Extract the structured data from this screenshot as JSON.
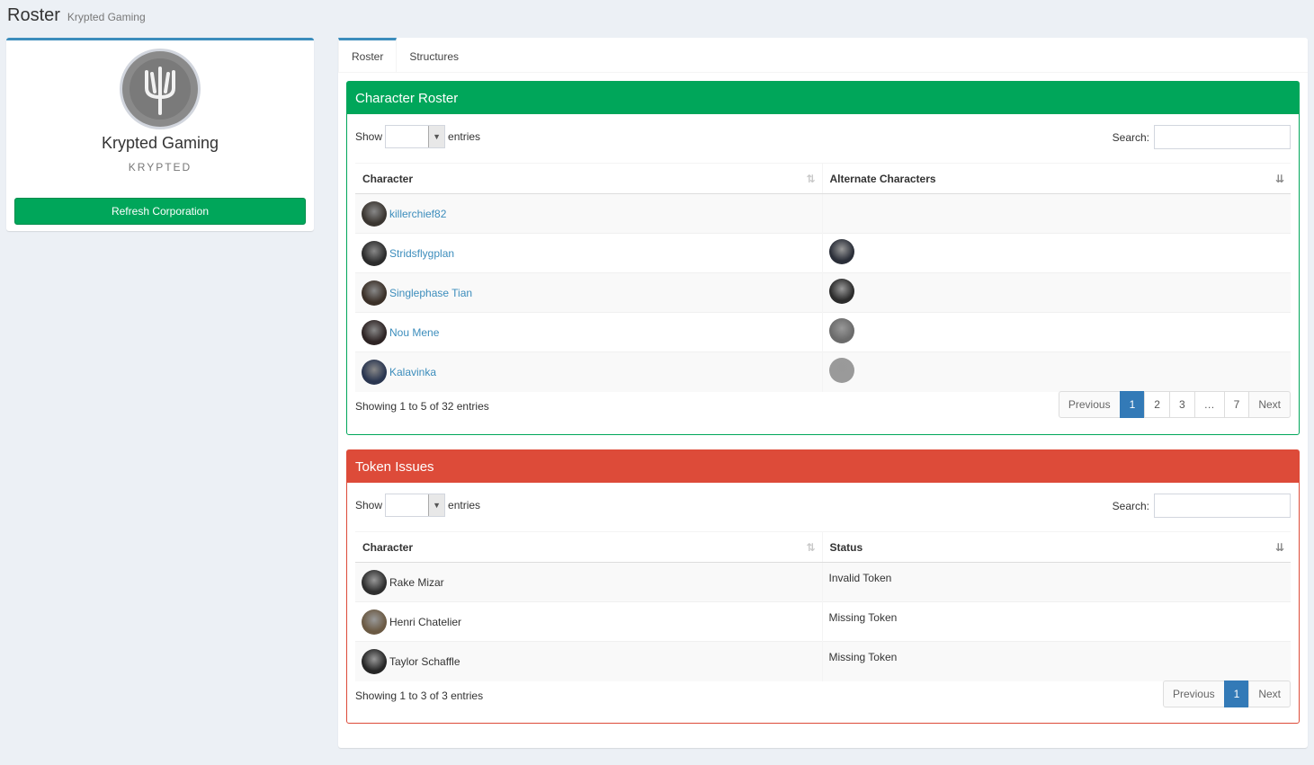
{
  "header": {
    "title": "Roster",
    "subtitle": "Krypted Gaming"
  },
  "profile": {
    "corp_name": "Krypted Gaming",
    "ticker": "KRYPTED",
    "refresh_label": "Refresh Corporation",
    "logo_icon": "trident-icon"
  },
  "tabs": [
    {
      "label": "Roster",
      "active": true
    },
    {
      "label": "Structures",
      "active": false
    }
  ],
  "roster": {
    "title": "Character Roster",
    "show_label": "Show",
    "entries_label": "entries",
    "search_label": "Search:",
    "columns": [
      "Character",
      "Alternate Characters"
    ],
    "rows": [
      {
        "name": "killerchief82",
        "avatar": "#3a3530",
        "alt": null
      },
      {
        "name": "Stridsflygplan",
        "avatar": "#2c2c2c",
        "alt": "#2a2e38"
      },
      {
        "name": "Singlephase Tian",
        "avatar": "#3b3028",
        "alt": "#2b2b2b"
      },
      {
        "name": "Nou Mene",
        "avatar": "#2e2424",
        "alt": "#6b6b6b"
      },
      {
        "name": "Kalavinka",
        "avatar": "#2a3650",
        "alt": "#9a9a9a"
      }
    ],
    "info": "Showing 1 to 5 of 32 entries",
    "pagination": {
      "previous": "Previous",
      "next": "Next",
      "pages": [
        "1",
        "2",
        "3",
        "…",
        "7"
      ],
      "active": "1"
    }
  },
  "token_issues": {
    "title": "Token Issues",
    "show_label": "Show",
    "entries_label": "entries",
    "search_label": "Search:",
    "columns": [
      "Character",
      "Status"
    ],
    "rows": [
      {
        "name": "Rake Mizar",
        "avatar": "#2e2e2e",
        "status": "Invalid Token"
      },
      {
        "name": "Henri Chatelier",
        "avatar": "#6b5a44",
        "status": "Missing Token"
      },
      {
        "name": "Taylor Schaffle",
        "avatar": "#262626",
        "status": "Missing Token"
      }
    ],
    "info": "Showing 1 to 3 of 3 entries",
    "pagination": {
      "previous": "Previous",
      "next": "Next",
      "pages": [
        "1"
      ],
      "active": "1"
    }
  },
  "colors": {
    "success": "#00a65a",
    "danger": "#dd4b39",
    "primary": "#3c8dbc",
    "page_active": "#337ab7",
    "background": "#ecf0f5"
  }
}
